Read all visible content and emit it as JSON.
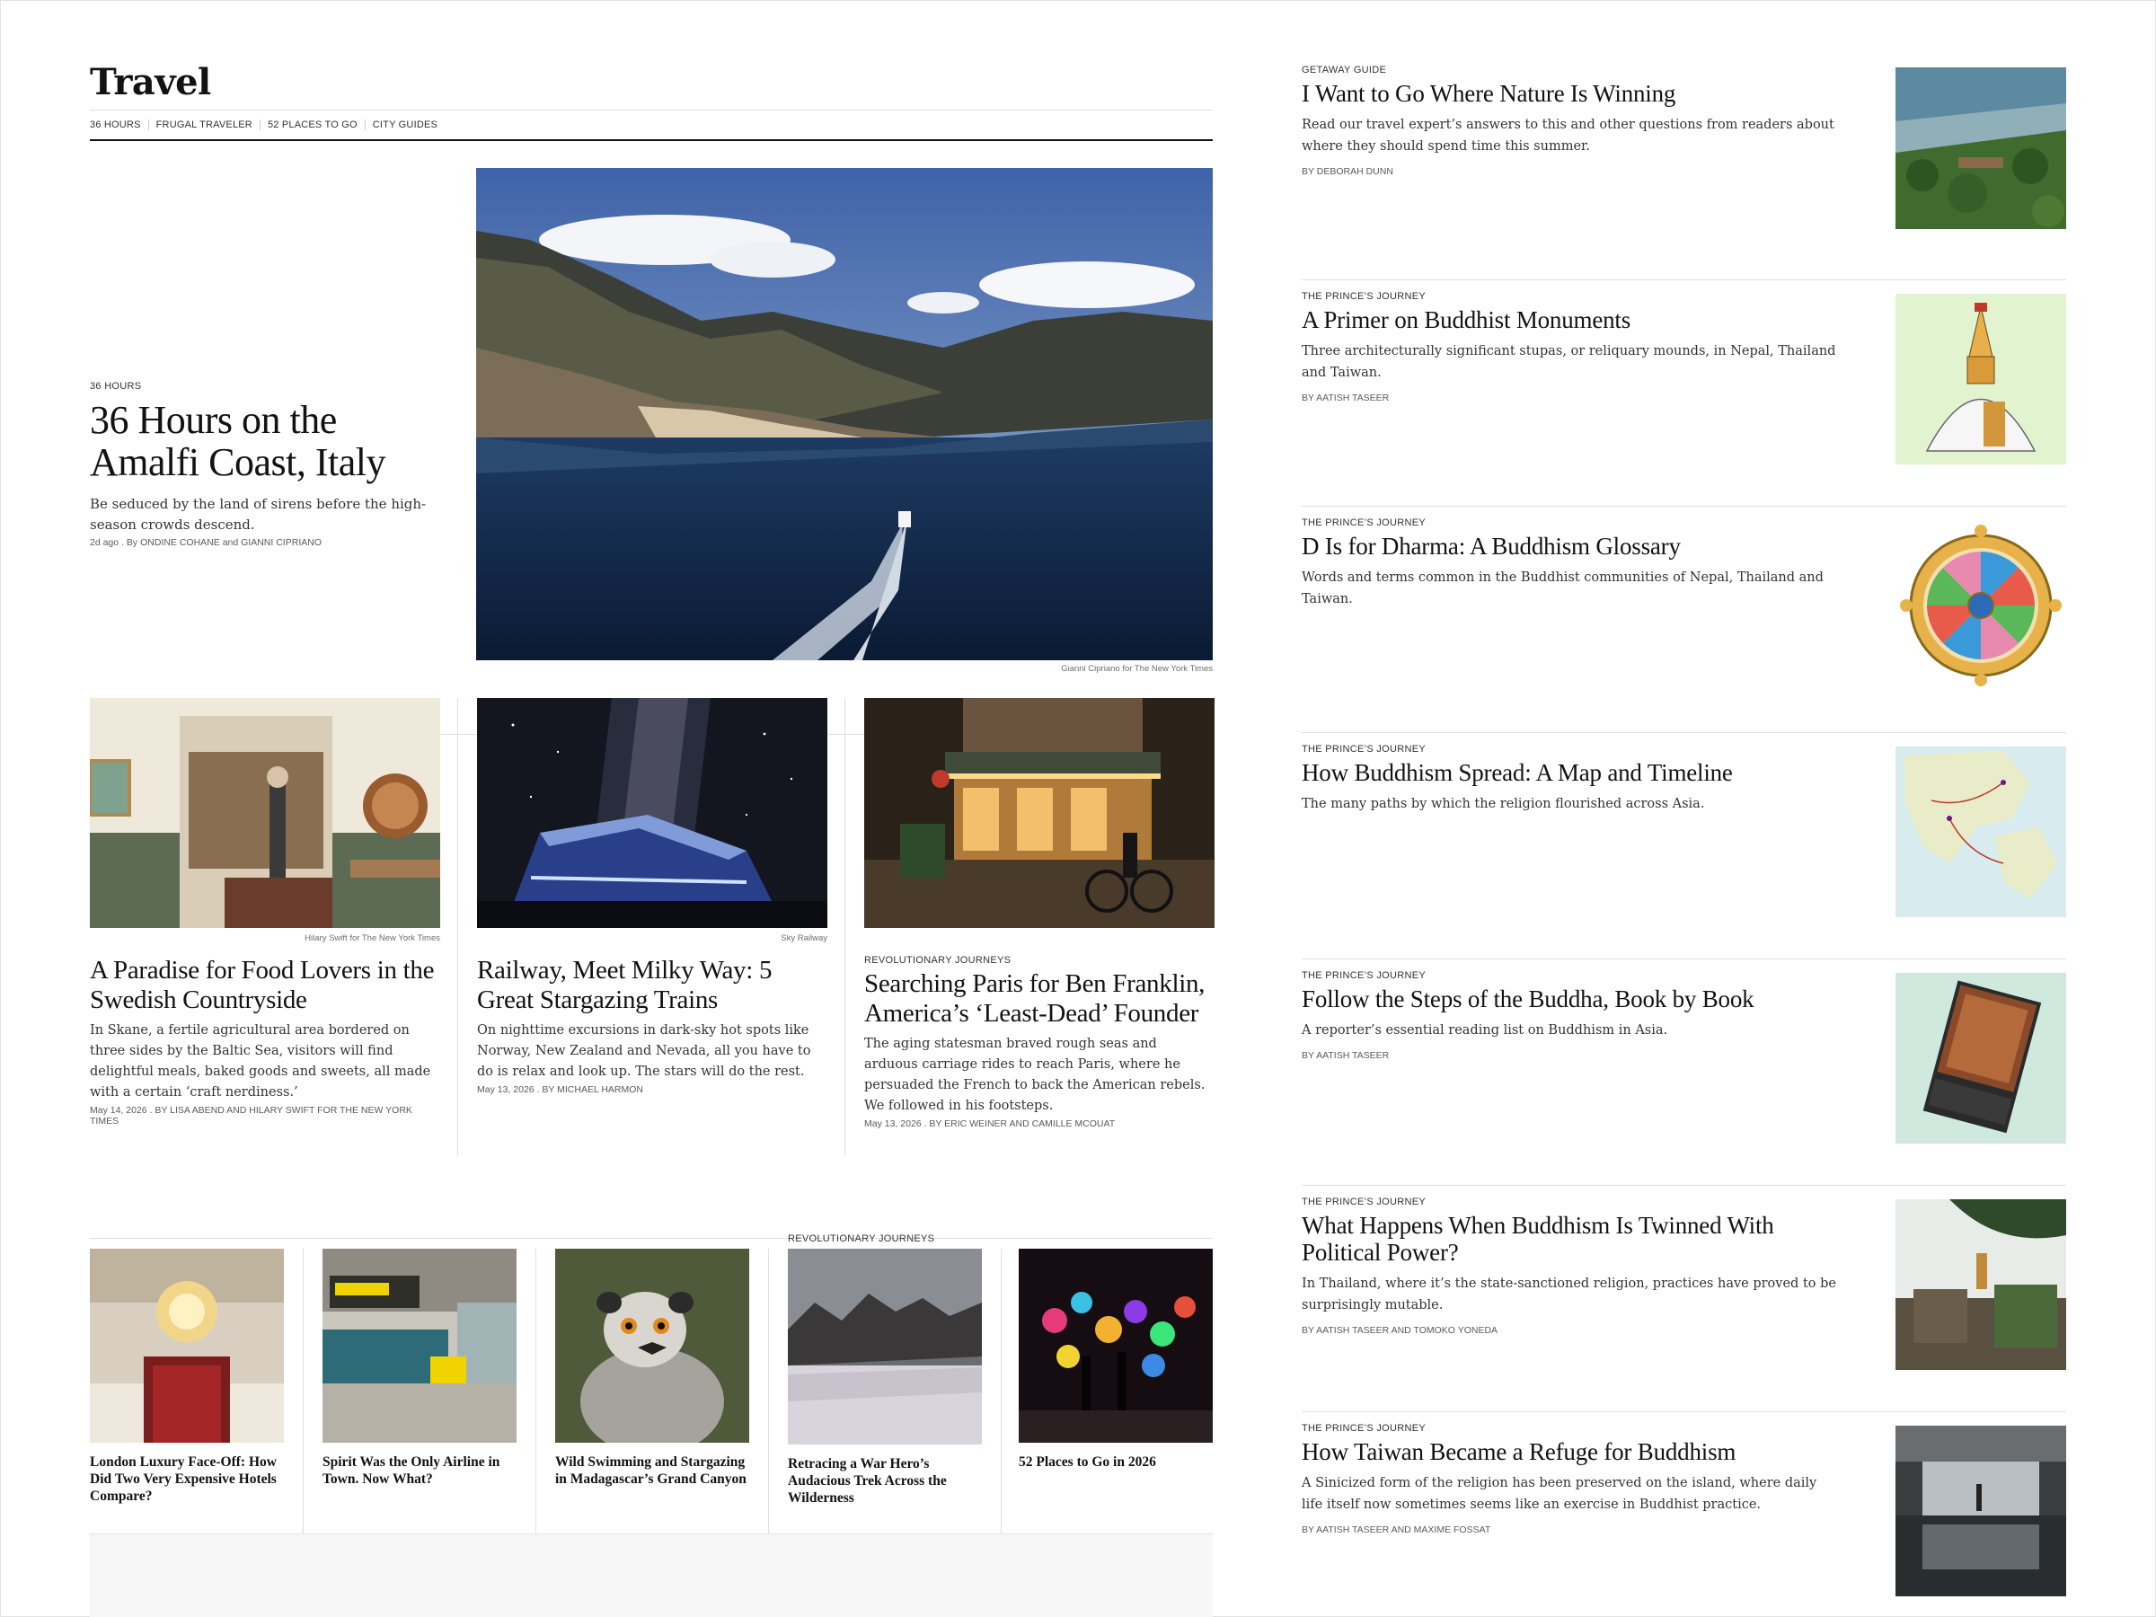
{
  "section": {
    "title": "Travel",
    "nav": [
      "36 Hours",
      "Frugal Traveler",
      "52 Places to Go",
      "City Guides"
    ]
  },
  "hero": {
    "kicker": "36 Hours",
    "headline": "36 Hours on the Amalfi Coast, Italy",
    "summary": "Be seduced by the land of sirens before the high-season crowds descend.",
    "date": "2d ago",
    "byline_prefix": "By",
    "author1": "Ondine Cohane",
    "byline_and": "and",
    "author2": "Gianni Cipriano",
    "credit": "Gianni Cipriano for The New York Times"
  },
  "row3": [
    {
      "credit": "Hilary Swift for The New York Times",
      "kicker": "",
      "headline": "A Paradise for Food Lovers in the Swedish Countryside",
      "summary": "In Skane, a fertile agricultural area bordered on three sides by the Baltic Sea, visitors will find delightful meals, baked goods and sweets, all made with a certain ‘craft nerdiness.’",
      "date": "May 14, 2026",
      "byline": "By Lisa Abend and Hilary Swift for The New York Times"
    },
    {
      "credit": "Sky Railway",
      "kicker": "",
      "headline": "Railway, Meet Milky Way: 5 Great Stargazing Trains",
      "summary": "On nighttime excursions in dark-sky hot spots like Norway, New Zealand and Nevada, all you have to do is relax and look up. The stars will do the rest.",
      "date": "May 13, 2026",
      "byline": "By Michael Harmon"
    },
    {
      "credit": "",
      "kicker": "Revolutionary Journeys",
      "headline": "Searching Paris for Ben Franklin, America’s ‘Least-Dead’ Founder",
      "summary": "The aging statesman braved rough seas and arduous carriage rides to reach Paris, where he persuaded the French to back the American rebels. We followed in his footsteps.",
      "date": "May 13, 2026",
      "byline": "By Eric Weiner and Camille Mcouat"
    }
  ],
  "row5": [
    {
      "kicker": "",
      "headline": "London Luxury Face-Off: How Did Two Very Expensive Hotels Compare?"
    },
    {
      "kicker": "",
      "headline": "Spirit Was the Only Airline in Town. Now What?"
    },
    {
      "kicker": "",
      "headline": "Wild Swimming and Stargazing in Madagascar’s Grand Canyon"
    },
    {
      "kicker": "Revolutionary Journeys",
      "headline": "Retracing a War Hero’s Audacious Trek Across the Wilderness"
    },
    {
      "kicker": "",
      "headline": "52 Places to Go in 2026"
    }
  ],
  "right": [
    {
      "kicker": "Getaway Guide",
      "headline": "I Want to Go Where Nature Is Winning",
      "summary": "Read our travel expert’s answers to this and other questions from readers about where they should spend time this summer.",
      "byline": "By Deborah Dunn"
    },
    {
      "kicker": "The Prince’s Journey",
      "headline": "A Primer on Buddhist Monuments",
      "summary": "Three architecturally significant stupas, or reliquary mounds, in Nepal, Thailand and Taiwan.",
      "byline": "By Aatish Taseer"
    },
    {
      "kicker": "The Prince’s Journey",
      "headline": "D Is for Dharma: A Buddhism Glossary",
      "summary": "Words and terms common in the Buddhist communities of Nepal, Thailand and Taiwan.",
      "byline": ""
    },
    {
      "kicker": "The Prince’s Journey",
      "headline": "How Buddhism Spread: A Map and Timeline",
      "summary": "The many paths by which the religion flourished across Asia.",
      "byline": ""
    },
    {
      "kicker": "The Prince’s Journey",
      "headline": "Follow the Steps of the Buddha, Book by Book",
      "summary": "A reporter’s essential reading list on Buddhism in Asia.",
      "byline": "By Aatish Taseer"
    },
    {
      "kicker": "The Prince’s Journey",
      "headline": "What Happens When Buddhism Is Twinned With Political Power?",
      "summary": "In Thailand, where it’s the state-sanctioned religion, practices have proved to be surprisingly mutable.",
      "byline": "By Aatish Taseer and Tomoko Yoneda"
    },
    {
      "kicker": "The Prince’s Journey",
      "headline": "How Taiwan Became a Refuge for Buddhism",
      "summary": "A Sinicized form of the religion has been preserved on the island, where daily life itself now sometimes seems like an exercise in Buddhist practice.",
      "byline": "By Aatish Taseer and Maxime Fossat"
    }
  ],
  "colors": {
    "text": "#121212",
    "rule": "#dfdfdf",
    "muted": "#5a5a5a"
  }
}
